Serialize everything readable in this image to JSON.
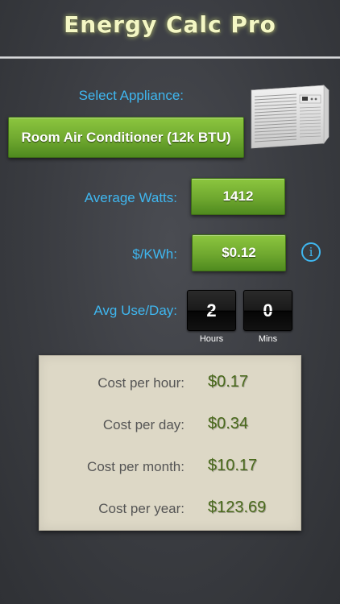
{
  "app": {
    "title": "Energy Calc Pro"
  },
  "appliance": {
    "select_label": "Select Appliance:",
    "selected": "Room Air Conditioner (12k BTU)",
    "image_icon": "air-conditioner-icon"
  },
  "watts": {
    "label": "Average Watts:",
    "value": "1412"
  },
  "rate": {
    "label": "$/KWh:",
    "value": "$0.12",
    "info_glyph": "i"
  },
  "usage": {
    "label": "Avg Use/Day:",
    "hours": "2",
    "mins": "0",
    "hours_label": "Hours",
    "mins_label": "Mins"
  },
  "results": [
    {
      "label": "Cost per hour:",
      "value": "$0.17"
    },
    {
      "label": "Cost per day:",
      "value": "$0.34"
    },
    {
      "label": "Cost per month:",
      "value": "$10.17"
    },
    {
      "label": "Cost per year:",
      "value": "$123.69"
    }
  ],
  "colors": {
    "accent_blue": "#3fb7f0",
    "button_green": "#6fa82f",
    "result_value_green": "#4a6a1c",
    "results_panel": "#ddd8c6"
  }
}
